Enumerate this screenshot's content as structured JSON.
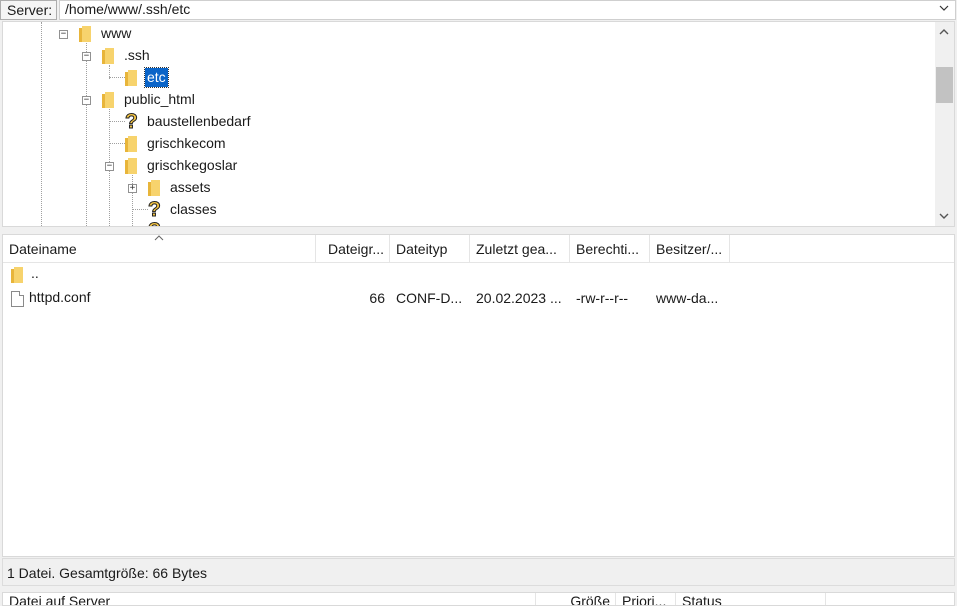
{
  "pathbar": {
    "label": "Server:",
    "path": "/home/www/.ssh/etc"
  },
  "tree": {
    "nodes": [
      {
        "label": "www",
        "type": "folder"
      },
      {
        "label": ".ssh",
        "type": "folder"
      },
      {
        "label": "etc",
        "type": "folder",
        "selected": true
      },
      {
        "label": "public_html",
        "type": "folder"
      },
      {
        "label": "baustellenbedarf",
        "type": "unknown"
      },
      {
        "label": "grischkecom",
        "type": "folder"
      },
      {
        "label": "grischkegoslar",
        "type": "folder"
      },
      {
        "label": "assets",
        "type": "folder"
      },
      {
        "label": "classes",
        "type": "unknown"
      }
    ]
  },
  "filelist": {
    "columns": [
      "Dateiname",
      "Dateigr...",
      "Dateityp",
      "Zuletzt gea...",
      "Berechti...",
      "Besitzer/..."
    ],
    "rows": [
      {
        "name": "..",
        "size": "",
        "type": "",
        "modified": "",
        "perms": "",
        "owner": ""
      },
      {
        "name": "httpd.conf",
        "size": "66",
        "type": "CONF-D...",
        "modified": "20.02.2023 ...",
        "perms": "-rw-r--r--",
        "owner": "www-da..."
      }
    ]
  },
  "status": {
    "text": "1 Datei. Gesamtgröße: 66 Bytes"
  },
  "queue": {
    "columns": [
      "Datei auf Server",
      "Größe",
      "Priori...",
      "Status"
    ]
  }
}
